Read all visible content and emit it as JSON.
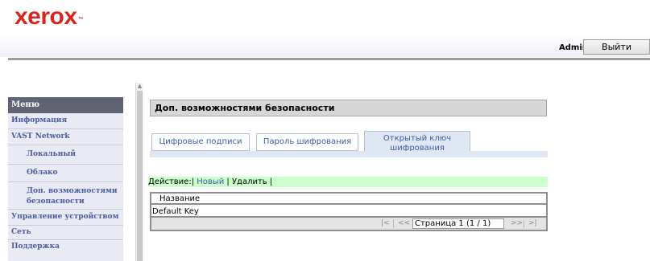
{
  "header": {
    "brand": "xerox",
    "trademark": "™",
    "user": "Admin",
    "logout_label": "Выйти"
  },
  "sidebar": {
    "title": "Меню",
    "items": [
      {
        "label": "Информация"
      },
      {
        "label": "VAST Network"
      },
      {
        "label": "Локальный"
      },
      {
        "label": "Облако"
      },
      {
        "label": "Доп. возможностями безопасности"
      },
      {
        "label": "Управление устройством"
      },
      {
        "label": "Сеть"
      },
      {
        "label": "Поддержка"
      }
    ]
  },
  "main": {
    "title": "Доп. возможностями безопасности",
    "tabs": [
      {
        "label": "Цифровые подписи",
        "active": false
      },
      {
        "label": "Пароль шифрования",
        "active": false
      },
      {
        "label": "Открытый ключ шифрования",
        "active": true
      }
    ],
    "actions": {
      "prefix": "Действие:|",
      "new_label": "Новый",
      "sep1": "|",
      "delete_label": "Удалить",
      "sep2": "|"
    },
    "table": {
      "columns": [
        "Название"
      ],
      "rows": [
        [
          "Default Key"
        ]
      ]
    },
    "pager": {
      "first": "|<",
      "prev": "<<",
      "page_text": "Страница 1 (1 / 1)",
      "next": ">>",
      "last": ">|"
    }
  },
  "colors": {
    "brand_red": "#d6261f",
    "link_blue": "#3a5ba8",
    "menu_header": "#5f6374",
    "action_bar": "#ccffcc"
  }
}
